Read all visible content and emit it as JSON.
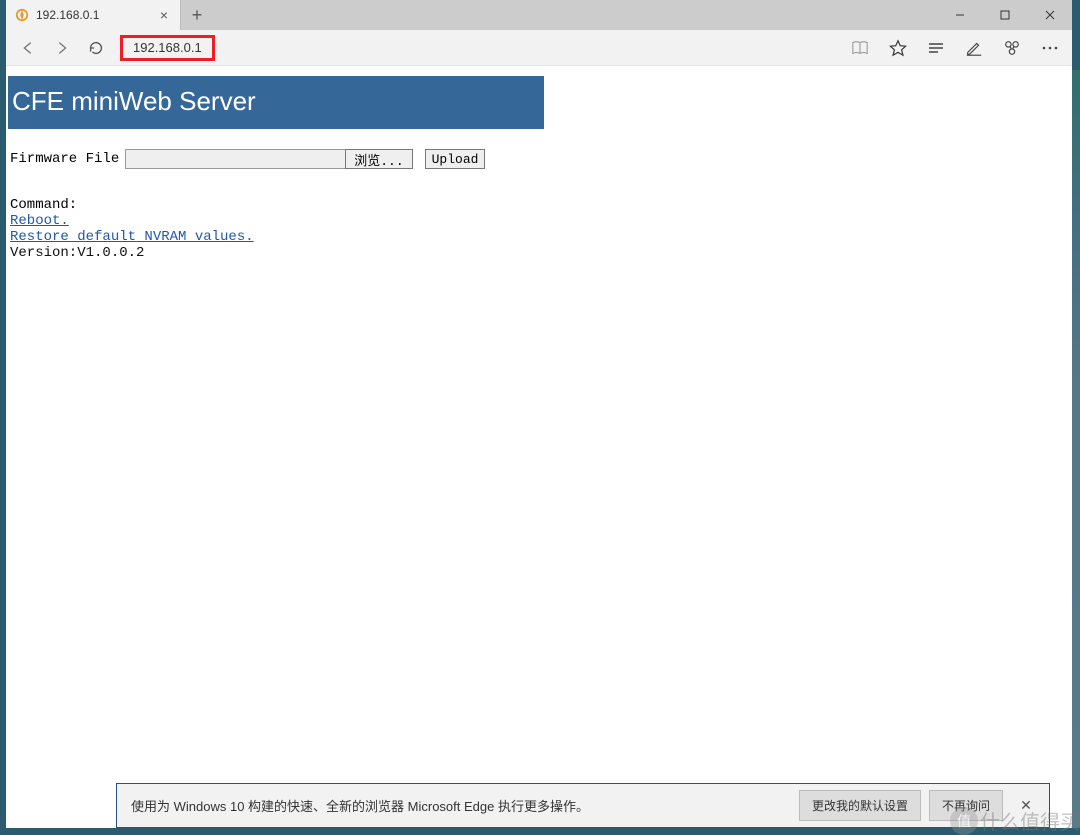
{
  "browser": {
    "tab_title": "192.168.0.1",
    "address": "192.168.0.1",
    "window_buttons": {
      "min": "—",
      "max": "▢",
      "close": "✕"
    }
  },
  "page": {
    "title": "CFE miniWeb Server",
    "firmware_label": "Firmware File",
    "browse_label": "浏览...",
    "upload_label": "Upload",
    "command_label": "Command:",
    "reboot_link": "Reboot.",
    "restore_link": "Restore default NVRAM values.",
    "version_text": "Version:V1.0.0.2"
  },
  "banner": {
    "message": "使用为 Windows 10 构建的快速、全新的浏览器 Microsoft Edge 执行更多操作。",
    "change_btn": "更改我的默认设置",
    "dismiss_btn": "不再询问"
  },
  "watermark": {
    "circle": "值",
    "text": "什么值得买"
  }
}
